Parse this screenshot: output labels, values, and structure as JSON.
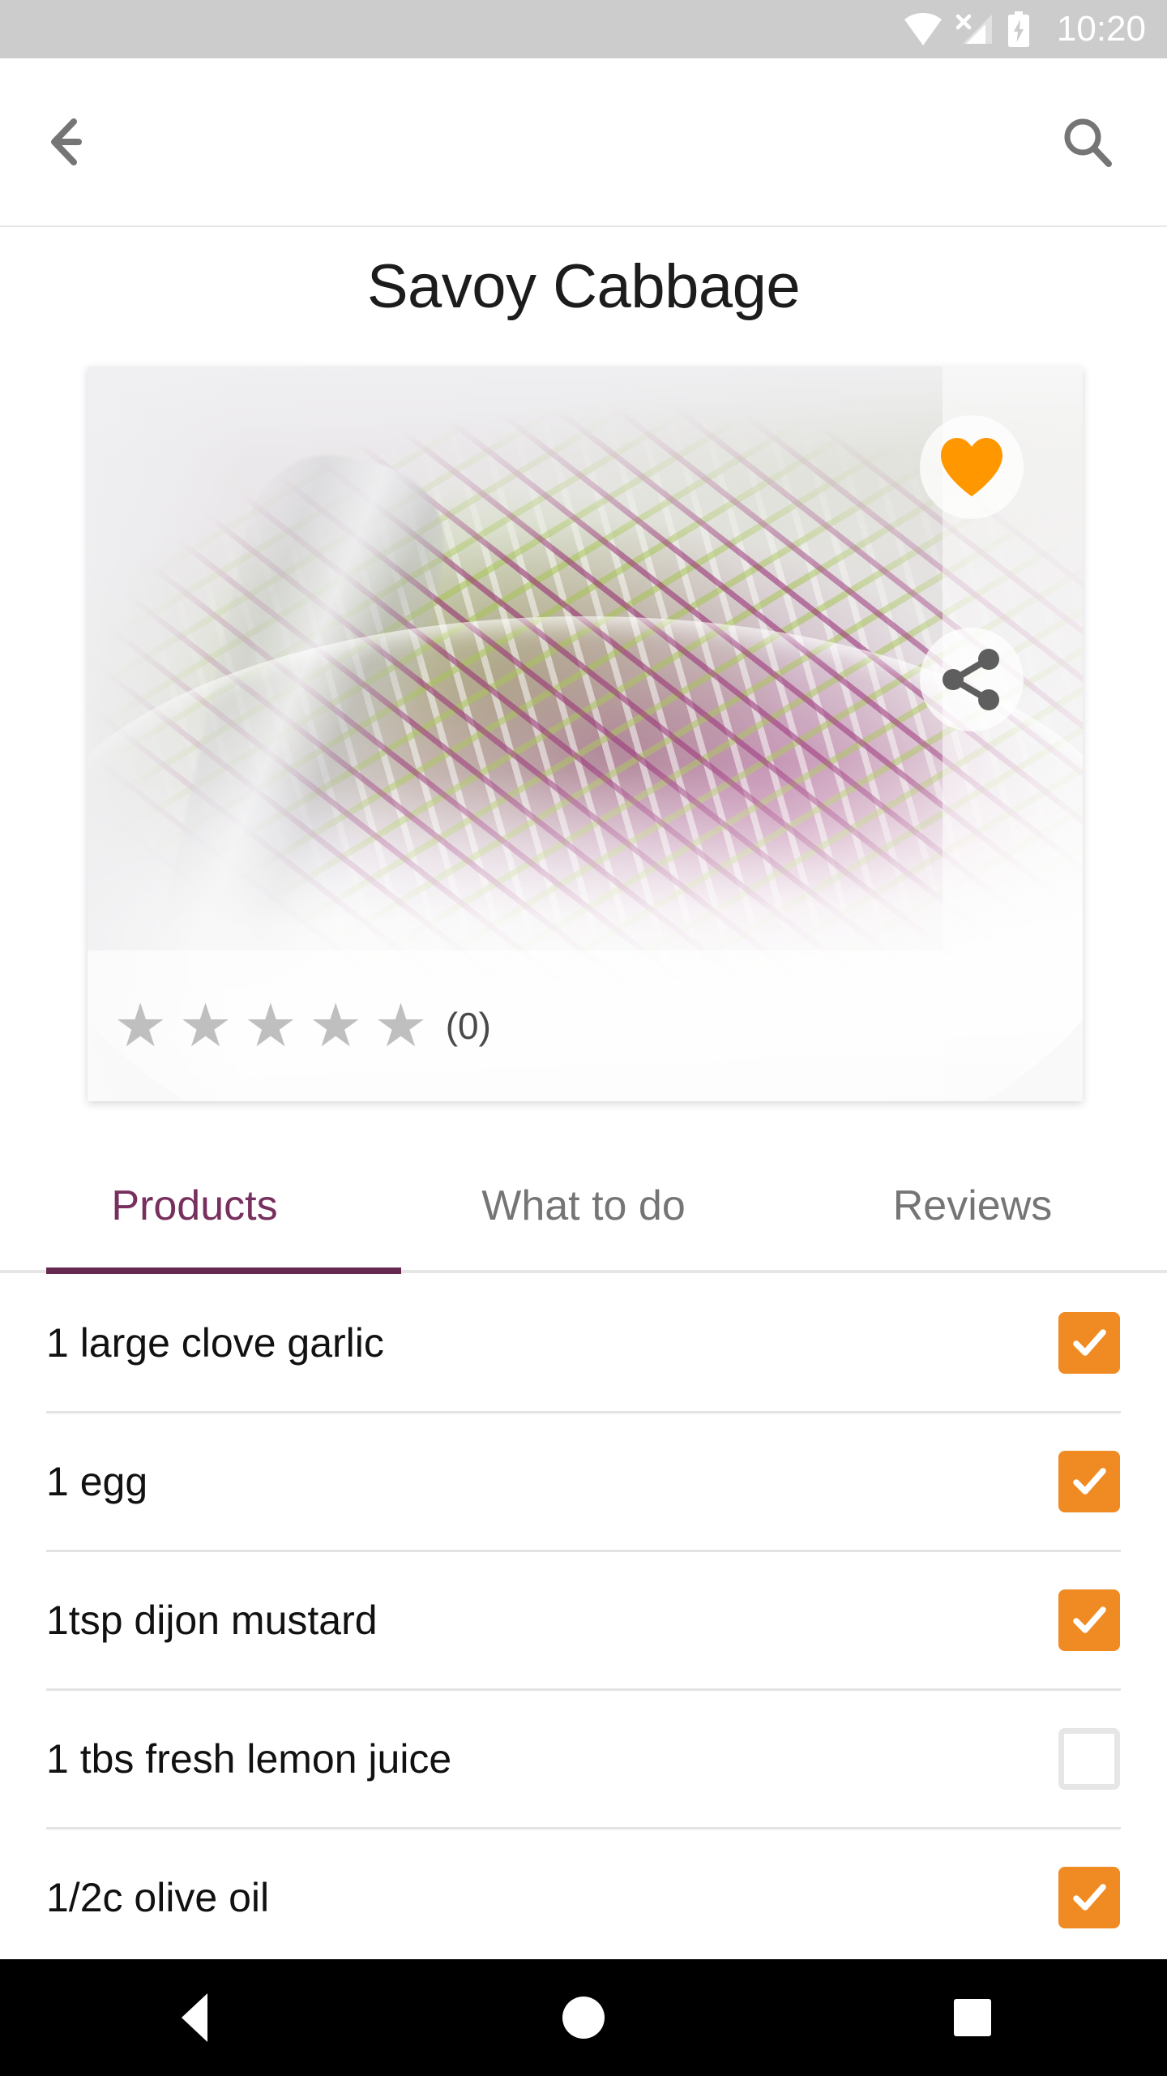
{
  "status_bar": {
    "time": "10:20",
    "icons": [
      "wifi-icon",
      "cellular-no-sim-icon",
      "battery-charging-icon"
    ],
    "background_color": "#CCCCCC",
    "foreground_color": "#FFFFFF"
  },
  "app_bar": {
    "back_icon": "back-arrow-icon",
    "search_icon": "search-icon",
    "icon_color": "#757575"
  },
  "recipe": {
    "title": "Savoy Cabbage",
    "favorite_icon": "heart-icon",
    "favorite_active": true,
    "favorite_color": "#FF9800",
    "share_icon": "share-icon",
    "share_color": "#5E5E5E",
    "rating": {
      "stars_total": 5,
      "stars_filled": 0,
      "star_glyph": "★",
      "star_color": "#BFBFBF",
      "count_label": "(0)"
    }
  },
  "tabs": {
    "active_index": 0,
    "active_color": "#77305E",
    "inactive_color": "#757575",
    "indicator_color": "#662A51",
    "items": [
      {
        "label": "Products"
      },
      {
        "label": "What to do"
      },
      {
        "label": "Reviews"
      }
    ]
  },
  "ingredients": {
    "checked_color": "#EF8B22",
    "unchecked_border_color": "#E6E6E6",
    "items": [
      {
        "label": "1 large clove garlic",
        "checked": true
      },
      {
        "label": "1 egg",
        "checked": true
      },
      {
        "label": "1tsp dijon mustard",
        "checked": true
      },
      {
        "label": "1 tbs fresh lemon juice",
        "checked": false
      },
      {
        "label": "1/2c olive oil",
        "checked": true
      }
    ]
  },
  "nav_bar": {
    "background_color": "#000000",
    "buttons": [
      {
        "icon": "android-back-icon"
      },
      {
        "icon": "android-home-icon"
      },
      {
        "icon": "android-recents-icon"
      }
    ]
  }
}
